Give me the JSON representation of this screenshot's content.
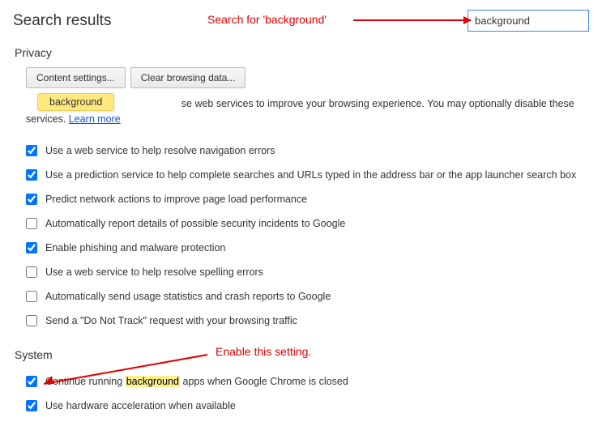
{
  "page_title": "Search results",
  "annotations": {
    "search": "Search for 'background'",
    "enable": "Enable this setting."
  },
  "search": {
    "value": "background",
    "clear_glyph": "✕"
  },
  "privacy": {
    "title": "Privacy",
    "content_settings_btn": "Content settings...",
    "clear_data_btn": "Clear browsing data...",
    "highlight": "background",
    "desc_tail": "se web services to improve your browsing experience. You may optionally disable these services. ",
    "learn_more": "Learn more",
    "options": [
      {
        "checked": true,
        "label": "Use a web service to help resolve navigation errors"
      },
      {
        "checked": true,
        "label": "Use a prediction service to help complete searches and URLs typed in the address bar or the app launcher search box"
      },
      {
        "checked": true,
        "label": "Predict network actions to improve page load performance"
      },
      {
        "checked": false,
        "label": "Automatically report details of possible security incidents to Google"
      },
      {
        "checked": true,
        "label": "Enable phishing and malware protection"
      },
      {
        "checked": false,
        "label": "Use a web service to help resolve spelling errors"
      },
      {
        "checked": false,
        "label": "Automatically send usage statistics and crash reports to Google"
      },
      {
        "checked": false,
        "label": "Send a \"Do Not Track\" request with your browsing traffic"
      }
    ]
  },
  "system": {
    "title": "System",
    "options": [
      {
        "checked": true,
        "pre": "Continue running ",
        "hl": "background",
        "post": " apps when Google Chrome is closed"
      },
      {
        "checked": true,
        "label": "Use hardware acceleration when available"
      }
    ]
  }
}
